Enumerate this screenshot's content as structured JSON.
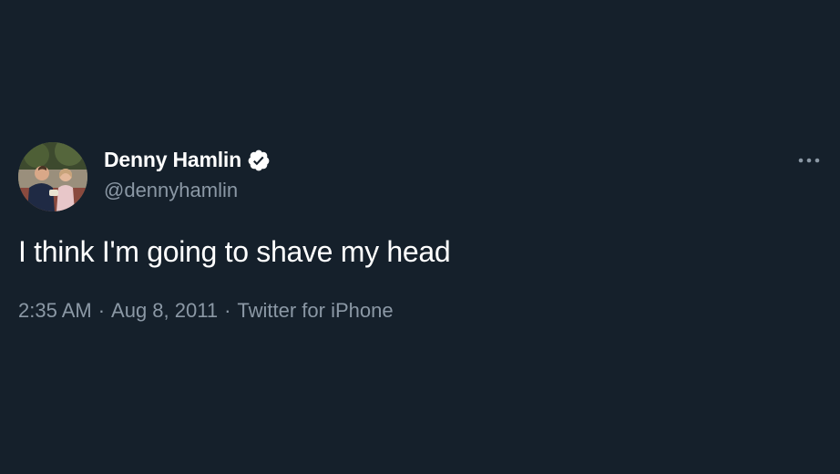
{
  "theme": {
    "background": "#15202b",
    "primary_text": "#ffffff",
    "secondary_text": "#8b98a5"
  },
  "author": {
    "display_name": "Denny Hamlin",
    "handle": "@dennyhamlin",
    "verified": true,
    "verified_icon": "verified-badge-icon",
    "avatar": "profile-photo"
  },
  "menu": {
    "icon": "more-options-icon"
  },
  "tweet": {
    "text": "I think I'm going to shave my head"
  },
  "meta": {
    "time": "2:35 AM",
    "separator": "·",
    "date": "Aug 8, 2011",
    "source": "Twitter for iPhone"
  }
}
